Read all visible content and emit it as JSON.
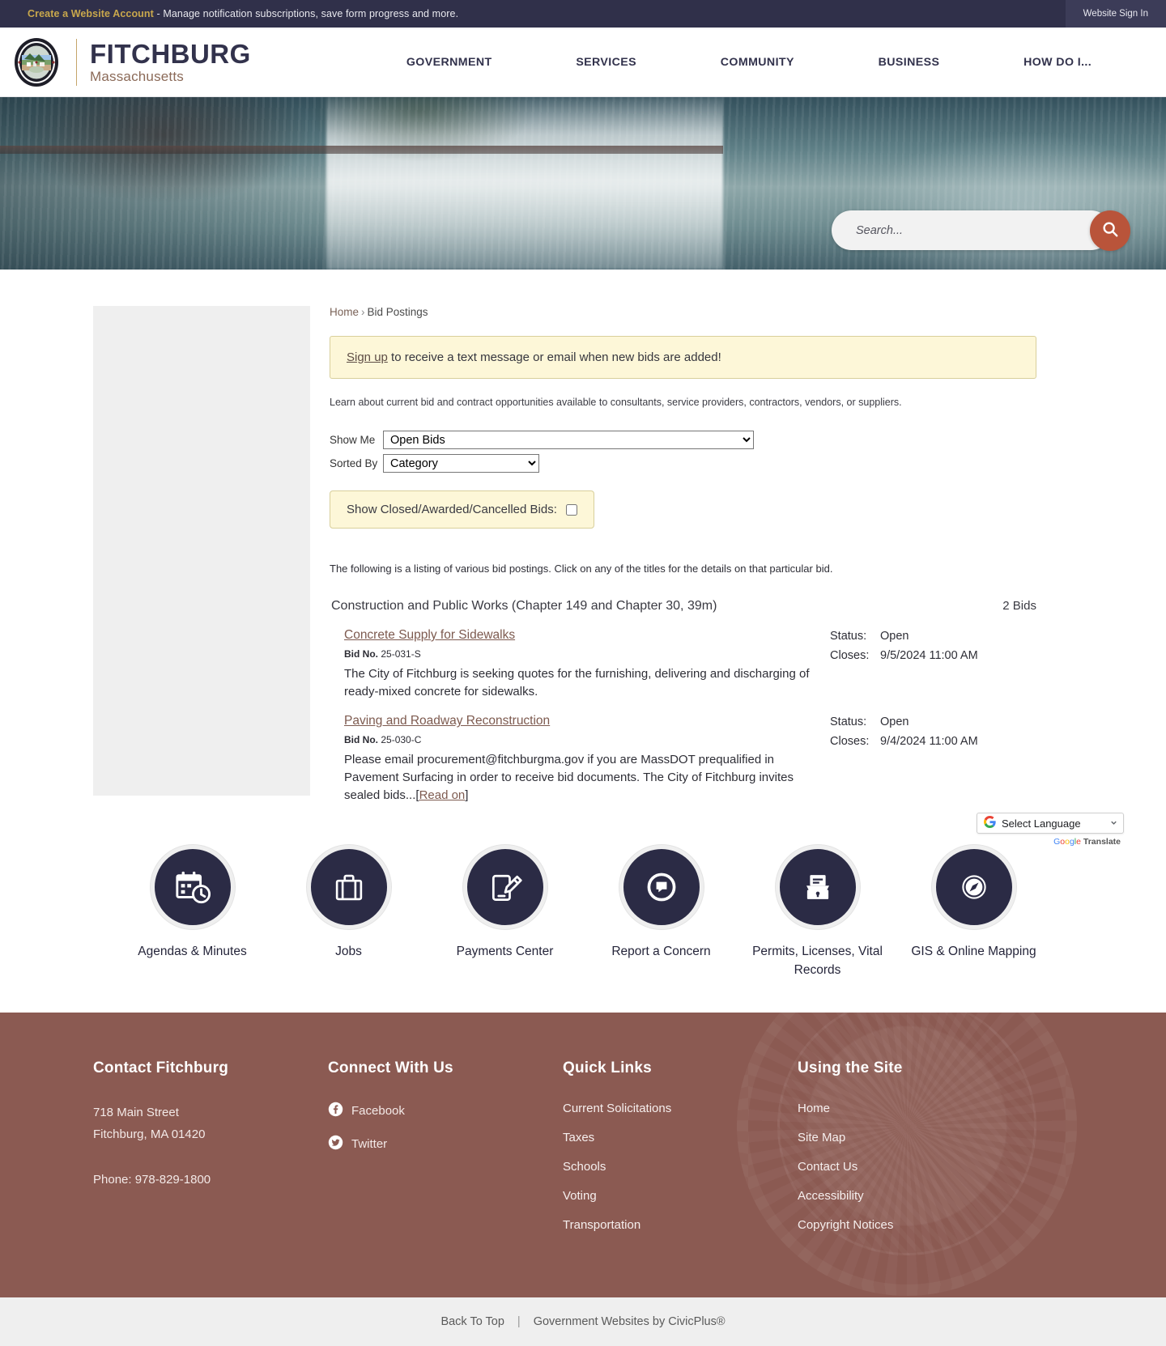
{
  "utility_bar": {
    "account_link": "Create a Website Account",
    "account_text": " - Manage notification subscriptions, save form progress and more.",
    "signin_label": "Website Sign In"
  },
  "header": {
    "brand_title": "FITCHBURG",
    "brand_subtitle": "Massachusetts",
    "nav": [
      {
        "label": "GOVERNMENT"
      },
      {
        "label": "SERVICES"
      },
      {
        "label": "COMMUNITY"
      },
      {
        "label": "BUSINESS"
      },
      {
        "label": "HOW DO I..."
      }
    ]
  },
  "hero": {
    "search_placeholder": "Search..."
  },
  "breadcrumb": {
    "home": "Home",
    "separator": "›",
    "current": "Bid Postings"
  },
  "notice": {
    "link": "Sign up",
    "text": " to receive a text message or email when new bids are added!"
  },
  "intro": "Learn about current bid and contract opportunities available to consultants, service providers, contractors, vendors, or suppliers.",
  "filters": {
    "show_me_label": "Show Me",
    "show_me_value": "Open Bids",
    "show_me_options": [
      "Open Bids"
    ],
    "sorted_by_label": "Sorted By",
    "sorted_by_value": "Category",
    "sorted_by_options": [
      "Category"
    ],
    "show_closed_label": "Show Closed/Awarded/Cancelled Bids:",
    "show_closed_checked": false
  },
  "listing_note": "The following is a listing of various bid postings. Click on any of the titles for the details on that particular bid.",
  "category": {
    "name": "Construction and Public Works (Chapter 149 and Chapter 30, 39m)",
    "count_label": "2 Bids"
  },
  "bids": [
    {
      "title": "Concrete Supply for Sidewalks",
      "bid_no_label": "Bid No.",
      "bid_no": "25-031-S",
      "description": "The City of Fitchburg is seeking quotes for the furnishing, delivering and discharging of ready-mixed concrete for sidewalks.",
      "read_on": "",
      "status_label": "Status:",
      "status_value": "Open",
      "closes_label": "Closes:",
      "closes_value": "9/5/2024 11:00 AM"
    },
    {
      "title": "Paving and Roadway Reconstruction",
      "bid_no_label": "Bid No.",
      "bid_no": "25-030-C",
      "description": "Please email procurement@fitchburgma.gov if you are MassDOT prequalified in Pavement Surfacing in order to receive bid documents. The City of Fitchburg invites sealed bids...",
      "read_on": "Read on",
      "status_label": "Status:",
      "status_value": "Open",
      "closes_label": "Closes:",
      "closes_value": "9/4/2024 11:00 AM"
    }
  ],
  "translate": {
    "selected": "Select Language",
    "powered_prefix": "",
    "google": "Google",
    "translate_word": "Translate"
  },
  "quick_links": [
    {
      "label": "Agendas & Minutes",
      "icon": "calendar-clock-icon"
    },
    {
      "label": "Jobs",
      "icon": "briefcase-icon"
    },
    {
      "label": "Payments Center",
      "icon": "mobile-payment-icon"
    },
    {
      "label": "Report a Concern",
      "icon": "speech-bubble-icon"
    },
    {
      "label": "Permits, Licenses, Vital Records",
      "icon": "file-drawer-icon"
    },
    {
      "label": "GIS & Online Mapping",
      "icon": "compass-icon"
    }
  ],
  "footer": {
    "contact": {
      "heading": "Contact Fitchburg",
      "address_line1": "718 Main Street",
      "address_line2": "Fitchburg, MA 01420",
      "phone": "Phone: 978-829-1800"
    },
    "connect": {
      "heading": "Connect With Us",
      "items": [
        {
          "label": "Facebook",
          "icon": "facebook-icon"
        },
        {
          "label": "Twitter",
          "icon": "twitter-icon"
        }
      ]
    },
    "quick_links": {
      "heading": "Quick Links",
      "items": [
        {
          "label": "Current Solicitations"
        },
        {
          "label": "Taxes"
        },
        {
          "label": "Schools"
        },
        {
          "label": "Voting"
        },
        {
          "label": "Transportation"
        }
      ]
    },
    "using_site": {
      "heading": "Using the Site",
      "items": [
        {
          "label": "Home"
        },
        {
          "label": "Site Map"
        },
        {
          "label": "Contact Us"
        },
        {
          "label": "Accessibility"
        },
        {
          "label": "Copyright Notices"
        }
      ]
    },
    "bottom": {
      "back_to_top": "Back To Top",
      "separator": "|",
      "credit": "Government Websites by CivicPlus®"
    }
  },
  "colors": {
    "navy": "#2b2b45",
    "footer_red": "#8b5a52",
    "accent_orange": "#b9543a",
    "gold": "#c9a84c",
    "notice_yellow": "#fdf7d8"
  }
}
